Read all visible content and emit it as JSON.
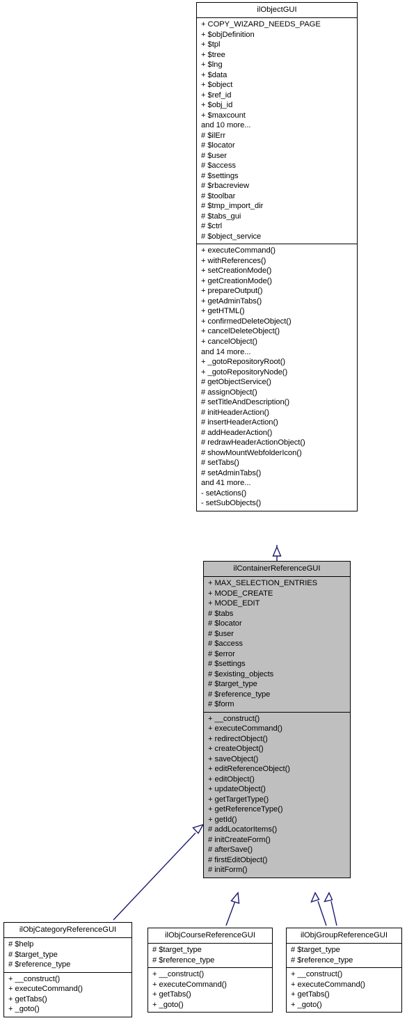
{
  "diagram": {
    "kind": "uml-class-inheritance-diagram",
    "title": "ilObjectGUI inheritance graph",
    "edge_color": "#191970",
    "fill_color": "#bfbfbf",
    "border_color": "#000000",
    "background_color": "#ffffff"
  },
  "classes": [
    {
      "id": "ilObjectGUI",
      "name": "ilObjectGUI",
      "highlighted": false,
      "attributes": [
        "+ COPY_WIZARD_NEEDS_PAGE",
        "+ $objDefinition",
        "+ $tpl",
        "+ $tree",
        "+ $lng",
        "+ $data",
        "+ $object",
        "+ $ref_id",
        "+ $obj_id",
        "+ $maxcount",
        "and 10 more...",
        "# $ilErr",
        "# $locator",
        "# $user",
        "# $access",
        "# $settings",
        "# $rbacreview",
        "# $toolbar",
        "# $tmp_import_dir",
        "# $tabs_gui",
        "# $ctrl",
        "# $object_service"
      ],
      "methods": [
        "+ executeCommand()",
        "+ withReferences()",
        "+ setCreationMode()",
        "+ getCreationMode()",
        "+ prepareOutput()",
        "+ getAdminTabs()",
        "+ getHTML()",
        "+ confirmedDeleteObject()",
        "+ cancelDeleteObject()",
        "+ cancelObject()",
        "and 14 more...",
        "+ _gotoRepositoryRoot()",
        "+ _gotoRepositoryNode()",
        "# getObjectService()",
        "# assignObject()",
        "# setTitleAndDescription()",
        "# initHeaderAction()",
        "# insertHeaderAction()",
        "# addHeaderAction()",
        "# redrawHeaderActionObject()",
        "# showMountWebfolderIcon()",
        "# setTabs()",
        "# setAdminTabs()",
        "and 41 more...",
        "- setActions()",
        "- setSubObjects()"
      ]
    },
    {
      "id": "ilContainerReferenceGUI",
      "name": "ilContainerReferenceGUI",
      "highlighted": true,
      "attributes": [
        "+ MAX_SELECTION_ENTRIES",
        "+ MODE_CREATE",
        "+ MODE_EDIT",
        "# $tabs",
        "# $locator",
        "# $user",
        "# $access",
        "# $error",
        "# $settings",
        "# $existing_objects",
        "# $target_type",
        "# $reference_type",
        "# $form"
      ],
      "methods": [
        "+ __construct()",
        "+ executeCommand()",
        "+ redirectObject()",
        "+ createObject()",
        "+ saveObject()",
        "+ editReferenceObject()",
        "+ editObject()",
        "+ updateObject()",
        "+ getTargetType()",
        "+ getReferenceType()",
        "+ getId()",
        "# addLocatorItems()",
        "# initCreateForm()",
        "# afterSave()",
        "# firstEditObject()",
        "# initForm()"
      ]
    },
    {
      "id": "ilObjCategoryReferenceGUI",
      "name": "ilObjCategoryReferenceGUI",
      "highlighted": false,
      "attributes": [
        "# $help",
        "# $target_type",
        "# $reference_type"
      ],
      "methods": [
        "+ __construct()",
        "+ executeCommand()",
        "+ getTabs()",
        "+ _goto()"
      ]
    },
    {
      "id": "ilObjCourseReferenceGUI",
      "name": "ilObjCourseReferenceGUI",
      "highlighted": false,
      "attributes": [
        "# $target_type",
        "# $reference_type"
      ],
      "methods": [
        "+ __construct()",
        "+ executeCommand()",
        "+ getTabs()",
        "+ _goto()"
      ]
    },
    {
      "id": "ilObjGroupReferenceGUI",
      "name": "ilObjGroupReferenceGUI",
      "highlighted": false,
      "attributes": [
        "# $target_type",
        "# $reference_type"
      ],
      "methods": [
        "+ __construct()",
        "+ executeCommand()",
        "+ getTabs()",
        "+ _goto()"
      ]
    }
  ],
  "edges": [
    {
      "from": "ilContainerReferenceGUI",
      "to": "ilObjectGUI",
      "type": "generalization"
    },
    {
      "from": "ilObjCategoryReferenceGUI",
      "to": "ilContainerReferenceGUI",
      "type": "generalization"
    },
    {
      "from": "ilObjCourseReferenceGUI",
      "to": "ilContainerReferenceGUI",
      "type": "generalization"
    },
    {
      "from": "ilObjGroupReferenceGUI",
      "to": "ilContainerReferenceGUI",
      "type": "generalization"
    },
    {
      "from": "ilObjGroupReferenceGUI",
      "to": "ilContainerReferenceGUI",
      "type": "generalization"
    }
  ]
}
